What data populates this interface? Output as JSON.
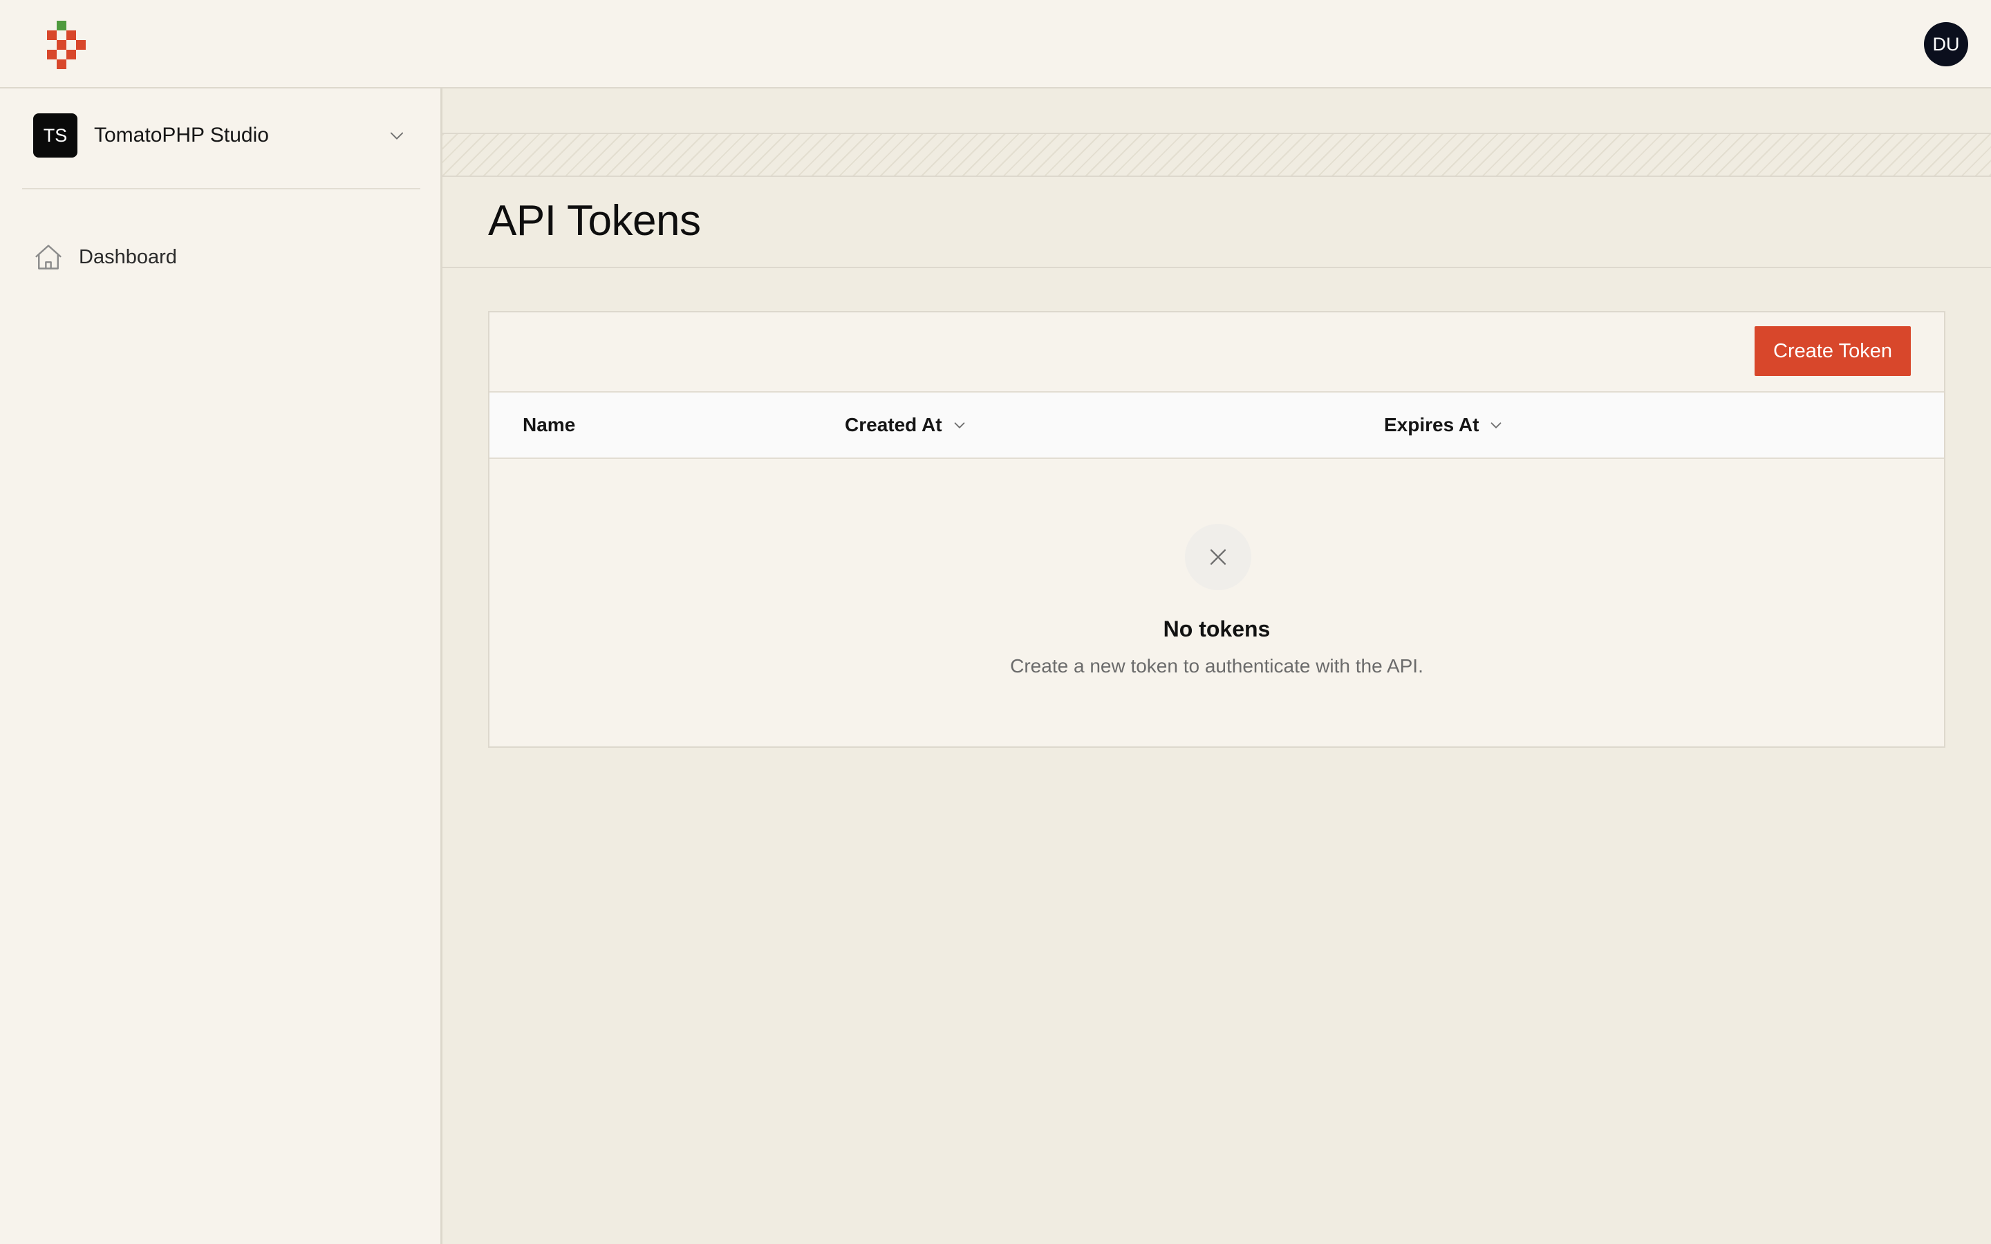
{
  "app": {
    "logo_icon": "tomato-pixel-logo-icon",
    "avatar_initials": "DU"
  },
  "sidebar": {
    "team": {
      "badge": "TS",
      "name": "TomatoPHP Studio",
      "icon": "chevron-down-icon"
    },
    "items": [
      {
        "label": "Dashboard",
        "icon": "home-icon"
      }
    ]
  },
  "page": {
    "title": "API Tokens"
  },
  "table": {
    "create_button_label": "Create Token",
    "columns": [
      {
        "label": "Name",
        "sortable": false
      },
      {
        "label": "Created At",
        "sortable": true
      },
      {
        "label": "Expires At",
        "sortable": true
      }
    ],
    "rows": [],
    "empty": {
      "icon": "close-icon",
      "title": "No tokens",
      "description": "Create a new token to authenticate with the API."
    }
  },
  "colors": {
    "accent": "#D8472B",
    "logo_green": "#4E9A3E",
    "background": "#F0ECE1",
    "surface": "#F7F3EC",
    "dark": "#0A0A0A"
  }
}
